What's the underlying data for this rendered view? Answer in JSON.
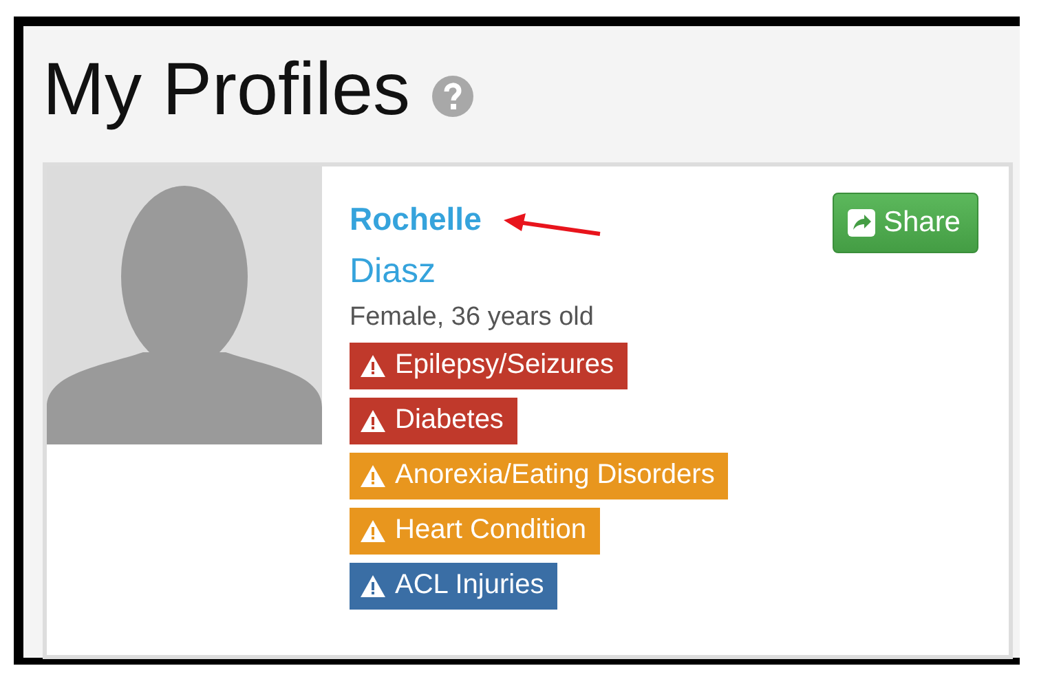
{
  "page": {
    "title": "My Profiles"
  },
  "profile": {
    "first_name": "Rochelle",
    "last_name": "Diasz",
    "details": "Female, 36 years old",
    "share_button": {
      "label": "Share"
    },
    "conditions": [
      {
        "label": "Epilepsy/Seizures",
        "color": "#c0392b"
      },
      {
        "label": "Diabetes",
        "color": "#c0392b"
      },
      {
        "label": "Anorexia/Eating Disorders",
        "color": "#e8961e"
      },
      {
        "label": "Heart Condition",
        "color": "#e8961e"
      },
      {
        "label": "ACL Injuries",
        "color": "#3a6ea5"
      }
    ]
  }
}
